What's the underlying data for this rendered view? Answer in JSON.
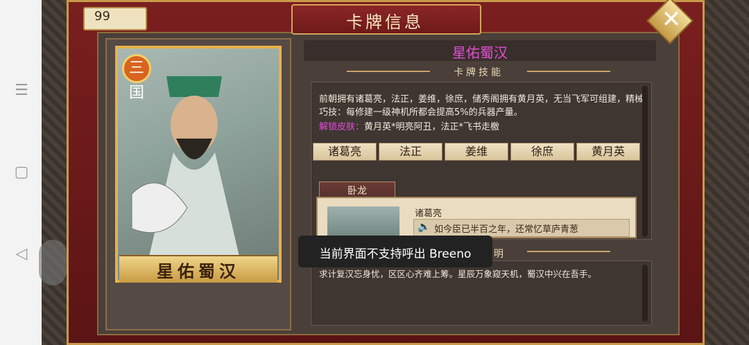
{
  "header": {
    "title": "卡牌信息",
    "count": "99"
  },
  "card": {
    "badge": "三国",
    "name": "星佑蜀汉"
  },
  "skill": {
    "title": "星佑蜀汉",
    "section_label": "卡牌技能",
    "description": "前朝拥有诸葛亮，法正，姜维，徐庶，储秀阁拥有黄月英，无当飞军可组建，精械巧技：每修建一级神机所都会提高5%的兵器产量。",
    "unlock_label": "解锁皮肤：",
    "unlock_value": "黄月英*明亮阿丑，法正*飞书走檄",
    "heroes": [
      "诸葛亮",
      "法正",
      "姜维",
      "徐庶",
      "黄月英"
    ]
  },
  "voice": {
    "tab": "卧龙",
    "speaker": "诸葛亮",
    "quote": "如今臣已半百之年，还常忆草庐青葱"
  },
  "section2": {
    "label_tail": "明",
    "text": "求计复汉忘身忧，区区心齐难上筹。星辰万象窥天机，蜀汉中兴在吾手。"
  },
  "toast": {
    "text": "当前界面不支持呼出 Breeno"
  },
  "colors": {
    "accent_pink": "#e04fd5",
    "gold": "#d3a657",
    "panel_red": "#7a1f1f"
  }
}
